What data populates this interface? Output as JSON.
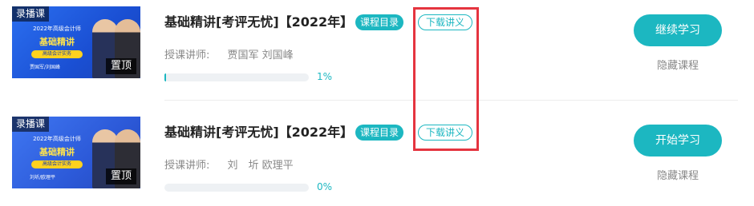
{
  "courses": [
    {
      "thumbnail": {
        "tag": "录播课",
        "subtitle": "2022年高级会计师",
        "title": "基础精讲",
        "pill": "高级会计实务",
        "names": "贾国军/刘国峰",
        "pin_label": "置顶"
      },
      "title": "基础精讲[考评无忧]【2022年】",
      "catalog_label": "课程目录",
      "download_label": "下载讲义",
      "teacher_label": "授课讲师:",
      "teacher_names": "贾国军 刘国峰",
      "progress_percent": 1,
      "progress_text": "1%",
      "action_label": "继续学习",
      "hide_label": "隐藏课程"
    },
    {
      "thumbnail": {
        "tag": "录播课",
        "subtitle": "2022年高级会计师",
        "title": "基础精讲",
        "pill": "高级会计实务",
        "names": "刘圻/欧理平",
        "pin_label": "置顶"
      },
      "title": "基础精讲[考评无忧]【2022年】",
      "catalog_label": "课程目录",
      "download_label": "下载讲义",
      "teacher_label": "授课讲师:",
      "teacher_names": "刘　圻 欧理平",
      "progress_percent": 0,
      "progress_text": "0%",
      "action_label": "开始学习",
      "hide_label": "隐藏课程"
    }
  ],
  "colors": {
    "accent": "#1cb7c1",
    "highlight": "#e5343f",
    "muted_text": "#888888"
  }
}
